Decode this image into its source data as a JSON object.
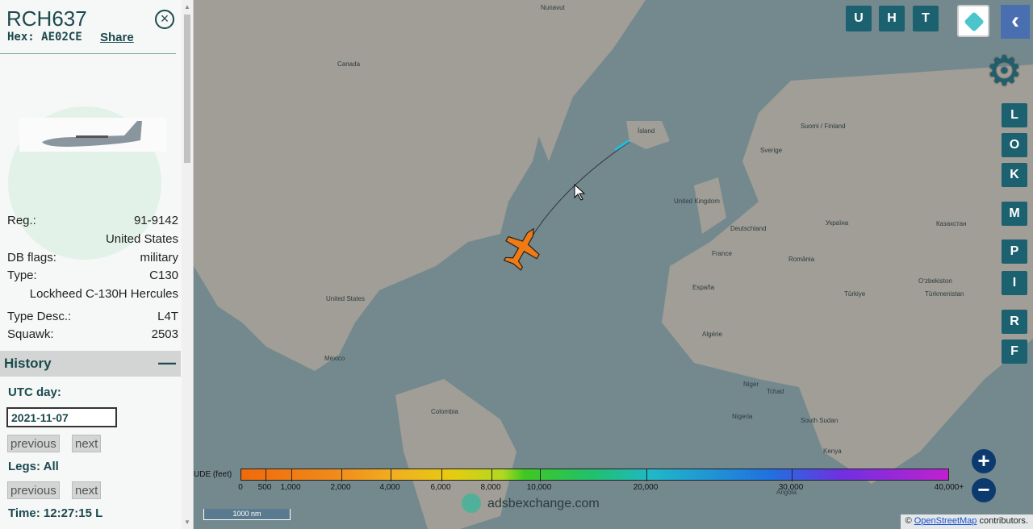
{
  "sidebar": {
    "callsign": "RCH637",
    "hex_label": "Hex:",
    "hex": "AE02CE",
    "share": "Share",
    "details": [
      {
        "label": "Reg.:",
        "value": "91-9142"
      },
      {
        "label": "",
        "value": "United States"
      },
      {
        "label": "DB flags:",
        "value": "military"
      },
      {
        "label": "Type:",
        "value": "C130"
      },
      {
        "label": "",
        "value": "Lockheed C-130H Hercules"
      },
      {
        "label": "Type Desc.:",
        "value": "L4T"
      },
      {
        "label": "Squawk:",
        "value": "2503"
      }
    ],
    "history": {
      "title": "History",
      "collapse": "—",
      "utc_day_label": "UTC day:",
      "utc_day": "2021-11-07",
      "previous": "previous",
      "next": "next",
      "legs_label": "Legs: All",
      "time_label": "Time: 12:27:15 L"
    }
  },
  "map": {
    "buttons_top": [
      "U",
      "H",
      "T"
    ],
    "side_buttons": [
      "L",
      "O",
      "K",
      "M",
      "P",
      "I",
      "R",
      "F"
    ],
    "labels": [
      {
        "t": "Nunavut"
      },
      {
        "t": "Canada"
      },
      {
        "t": "Ísland"
      },
      {
        "t": "Sverige"
      },
      {
        "t": "Suomi / Finland"
      },
      {
        "t": "United Kingdom"
      },
      {
        "t": "Deutschland"
      },
      {
        "t": "Україна"
      },
      {
        "t": "Казахстан"
      },
      {
        "t": "France"
      },
      {
        "t": "România"
      },
      {
        "t": "España"
      },
      {
        "t": "Türkiye"
      },
      {
        "t": "United States"
      },
      {
        "t": "México"
      },
      {
        "t": "Colombia"
      },
      {
        "t": "Algérie"
      },
      {
        "t": "Niger"
      },
      {
        "t": "Tchad"
      },
      {
        "t": "Nigeria"
      },
      {
        "t": "South Sudan"
      },
      {
        "t": "Kenya"
      },
      {
        "t": "Angola"
      },
      {
        "t": "Oʻzbekiston"
      },
      {
        "t": "Türkmenistan"
      }
    ],
    "legend": {
      "title": "UDE (feet)",
      "ticks": [
        "0",
        "500",
        "1,000",
        "2,000",
        "4,000",
        "6,000",
        "8,000",
        "10,000",
        "20,000",
        "30,000",
        "40,000+"
      ]
    },
    "scale": "1000 nm",
    "watermark": "adsbexchange.com",
    "attribution_prefix": "© ",
    "attribution_link": "OpenStreetMap",
    "attribution_suffix": " contributors.",
    "zoom_in": "+",
    "zoom_out": "−",
    "colors": {
      "ocean": "#73898e",
      "land": "#a09e96",
      "aircraft": "#f07a14",
      "button": "#1b6170"
    }
  }
}
